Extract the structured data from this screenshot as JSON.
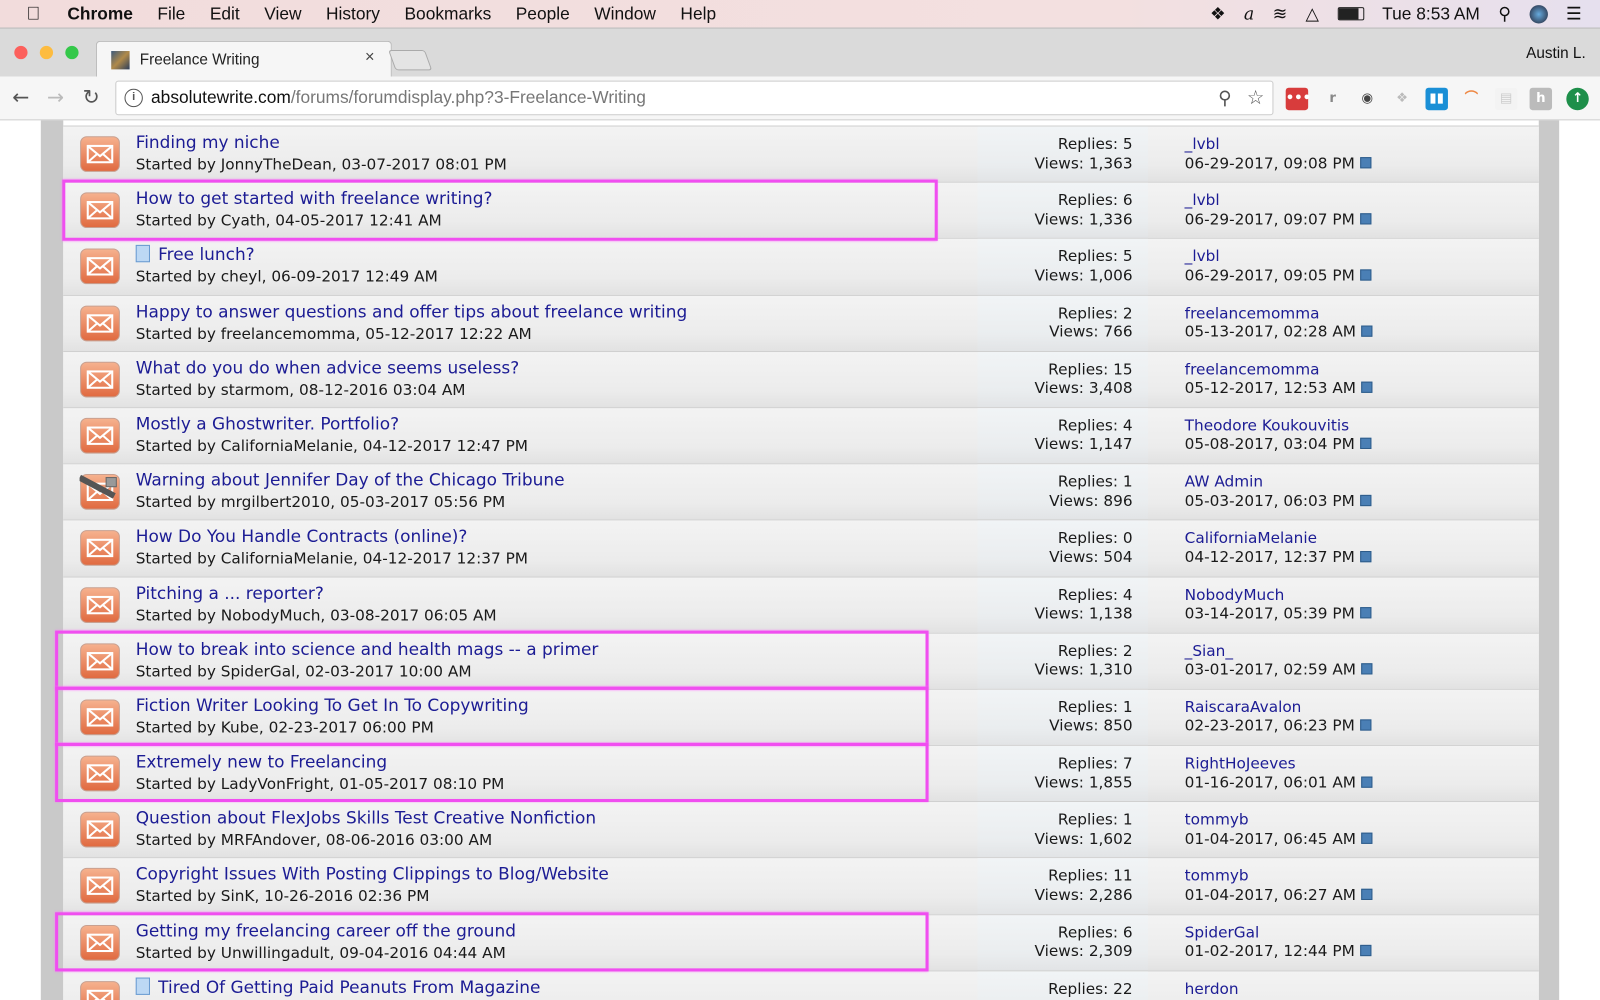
{
  "menubar": {
    "app": "Chrome",
    "items": [
      "File",
      "Edit",
      "View",
      "History",
      "Bookmarks",
      "People",
      "Window",
      "Help"
    ],
    "clock": "Tue 8:53 AM"
  },
  "browser": {
    "tab_title": "Freelance Writing",
    "profile": "Austin L.",
    "url_host": "absolutewrite.com",
    "url_path": "/forums/forumdisplay.php?3-Freelance-Writing"
  },
  "colors": {
    "link": "#1c1c94",
    "highlight": "#f04ef0",
    "icon": "#e8825a"
  },
  "threads": [
    {
      "title": "Finding my niche",
      "starter": "Started by JonnyTheDean, 03-07-2017 08:01 PM",
      "replies": "Replies: 5",
      "views": "Views: 1,363",
      "last_poster": "_lvbl",
      "last_date": "06-29-2017, 09:08 PM",
      "icon": "envelope",
      "doc": false,
      "highlighted": false
    },
    {
      "title": "How to get started with freelance writing?",
      "starter": "Started by Cyath, 04-05-2017 12:41 AM",
      "replies": "Replies: 6",
      "views": "Views: 1,336",
      "last_poster": "_lvbl",
      "last_date": "06-29-2017, 09:07 PM",
      "icon": "envelope",
      "doc": false,
      "highlighted": true
    },
    {
      "title": "Free lunch?",
      "starter": "Started by cheyl, 06-09-2017 12:49 AM",
      "replies": "Replies: 5",
      "views": "Views: 1,006",
      "last_poster": "_lvbl",
      "last_date": "06-29-2017, 09:05 PM",
      "icon": "envelope",
      "doc": true,
      "highlighted": false
    },
    {
      "title": "Happy to answer questions and offer tips about freelance writing",
      "starter": "Started by freelancemomma, 05-12-2017 12:22 AM",
      "replies": "Replies: 2",
      "views": "Views: 766",
      "last_poster": "freelancemomma",
      "last_date": "05-13-2017, 02:28 AM",
      "icon": "envelope",
      "doc": false,
      "highlighted": false
    },
    {
      "title": "What do you do when advice seems useless?",
      "starter": "Started by starmom, 08-12-2016 03:04 AM",
      "replies": "Replies: 15",
      "views": "Views: 3,408",
      "last_poster": "freelancemomma",
      "last_date": "05-12-2017, 12:53 AM",
      "icon": "envelope",
      "doc": false,
      "highlighted": false
    },
    {
      "title": "Mostly a Ghostwriter. Portfolio?",
      "starter": "Started by CaliforniaMelanie, 04-12-2017 12:47 PM",
      "replies": "Replies: 4",
      "views": "Views: 1,147",
      "last_poster": "Theodore Koukouvitis",
      "last_date": "05-08-2017, 03:04 PM",
      "icon": "envelope",
      "doc": false,
      "highlighted": false
    },
    {
      "title": "Warning about Jennifer Day of the Chicago Tribune",
      "starter": "Started by mrgilbert2010, 05-03-2017 05:56 PM",
      "replies": "Replies: 1",
      "views": "Views: 896",
      "last_poster": "AW Admin",
      "last_date": "05-03-2017, 06:03 PM",
      "icon": "locked",
      "doc": false,
      "highlighted": false
    },
    {
      "title": "How Do You Handle Contracts (online)?",
      "starter": "Started by CaliforniaMelanie, 04-12-2017 12:37 PM",
      "replies": "Replies: 0",
      "views": "Views: 504",
      "last_poster": "CaliforniaMelanie",
      "last_date": "04-12-2017, 12:37 PM",
      "icon": "envelope",
      "doc": false,
      "highlighted": false
    },
    {
      "title": "Pitching a ... reporter?",
      "starter": "Started by NobodyMuch, 03-08-2017 06:05 AM",
      "replies": "Replies: 4",
      "views": "Views: 1,138",
      "last_poster": "NobodyMuch",
      "last_date": "03-14-2017, 05:39 PM",
      "icon": "envelope",
      "doc": false,
      "highlighted": false
    },
    {
      "title": "How to break into science and health mags -- a primer",
      "starter": "Started by SpiderGal, 02-03-2017 10:00 AM",
      "replies": "Replies: 2",
      "views": "Views: 1,310",
      "last_poster": "_Sian_",
      "last_date": "03-01-2017, 02:59 AM",
      "icon": "envelope",
      "doc": false,
      "highlighted": true
    },
    {
      "title": "Fiction Writer Looking To Get In To Copywriting",
      "starter": "Started by Kube, 02-23-2017 06:00 PM",
      "replies": "Replies: 1",
      "views": "Views: 850",
      "last_poster": "RaiscaraAvalon",
      "last_date": "02-23-2017, 06:23 PM",
      "icon": "envelope",
      "doc": false,
      "highlighted": true
    },
    {
      "title": "Extremely new to Freelancing",
      "starter": "Started by LadyVonFright, 01-05-2017 08:10 PM",
      "replies": "Replies: 7",
      "views": "Views: 1,855",
      "last_poster": "RightHoJeeves",
      "last_date": "01-16-2017, 06:01 AM",
      "icon": "envelope",
      "doc": false,
      "highlighted": true
    },
    {
      "title": "Question about FlexJobs Skills Test Creative Nonfiction",
      "starter": "Started by MRFAndover, 08-06-2016 03:00 AM",
      "replies": "Replies: 1",
      "views": "Views: 1,602",
      "last_poster": "tommyb",
      "last_date": "01-04-2017, 06:45 AM",
      "icon": "envelope",
      "doc": false,
      "highlighted": false
    },
    {
      "title": "Copyright Issues With Posting Clippings to Blog/Website",
      "starter": "Started by SinK, 10-26-2016 02:36 PM",
      "replies": "Replies: 11",
      "views": "Views: 2,286",
      "last_poster": "tommyb",
      "last_date": "01-04-2017, 06:27 AM",
      "icon": "envelope",
      "doc": false,
      "highlighted": false
    },
    {
      "title": "Getting my freelancing career off the ground",
      "starter": "Started by Unwillingadult, 09-04-2016 04:44 AM",
      "replies": "Replies: 6",
      "views": "Views: 2,309",
      "last_poster": "SpiderGal",
      "last_date": "01-02-2017, 12:44 PM",
      "icon": "envelope",
      "doc": false,
      "highlighted": true
    },
    {
      "title": "Tired Of Getting Paid Peanuts From Magazine",
      "starter": "",
      "replies": "Replies: 22",
      "views": "",
      "last_poster": "herdon",
      "last_date": "",
      "icon": "envelope",
      "doc": true,
      "highlighted": false
    }
  ]
}
